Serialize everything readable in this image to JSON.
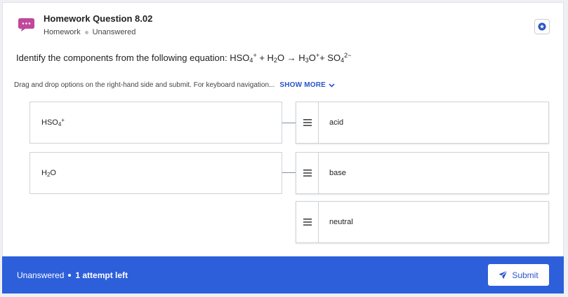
{
  "header": {
    "title": "Homework Question 8.02",
    "category": "Homework",
    "status": "Unanswered",
    "icon": "chat-bubble-icon",
    "accent_color": "#c0489b"
  },
  "question": {
    "prefix": "Identify the components from the following equation: HSO",
    "s1": "4",
    "c1": "+",
    "t2": " + H",
    "s2": "2",
    "t3": "O → H",
    "s3": "3",
    "t4": "O",
    "c4": "+",
    "t5": "+ SO",
    "s5": "4",
    "c5": "2−"
  },
  "instructions": {
    "text": "Drag and drop options on the right-hand side and submit. For keyboard navigation...",
    "show_more": "SHOW MORE"
  },
  "prompts": [
    {
      "base": "HSO",
      "sub": "4",
      "sup": "+"
    },
    {
      "base": "H",
      "sub": "2",
      "rest": "O"
    }
  ],
  "options": [
    {
      "label": "acid"
    },
    {
      "label": "base"
    },
    {
      "label": "neutral"
    }
  ],
  "footer": {
    "status": "Unanswered",
    "attempts": "1 attempt left",
    "submit_label": "Submit",
    "background_color": "#2d5fdb"
  }
}
